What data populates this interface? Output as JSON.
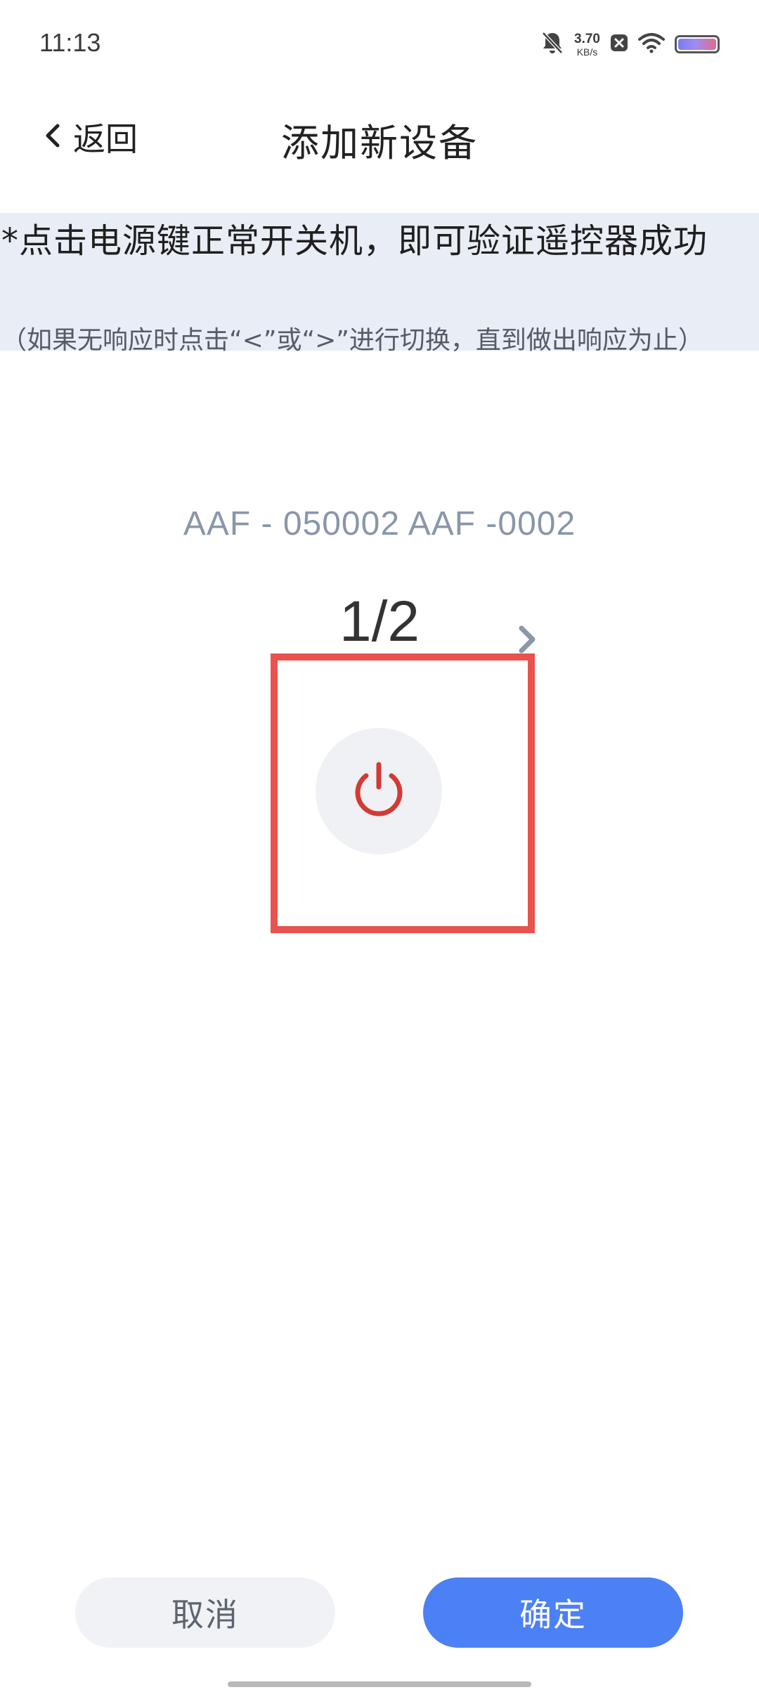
{
  "status_bar": {
    "time": "11:13",
    "net_speed_value": "3.70",
    "net_speed_unit": "KB/s",
    "icons": [
      "bell-muted-icon",
      "close-box-icon",
      "wifi-icon",
      "battery-icon"
    ]
  },
  "header": {
    "back_label": "返回",
    "title": "添加新设备"
  },
  "instruction": {
    "main": "*点击电源键正常开关机，即可验证遥控器成功",
    "sub": "（如果无响应时点击“<”或“>”进行切换，直到做出响应为止）"
  },
  "device": {
    "model": "AAF - 050002 AAF -0002",
    "page_indicator": "1/2",
    "current_page": 1,
    "total_pages": 2
  },
  "power_button": {
    "icon": "power-icon",
    "color": "#d33a36"
  },
  "actions": {
    "cancel_label": "取消",
    "confirm_label": "确定"
  },
  "colors": {
    "accent": "#4c80f5",
    "highlight": "#e9524d",
    "instruction_bg": "#e9edf5"
  }
}
